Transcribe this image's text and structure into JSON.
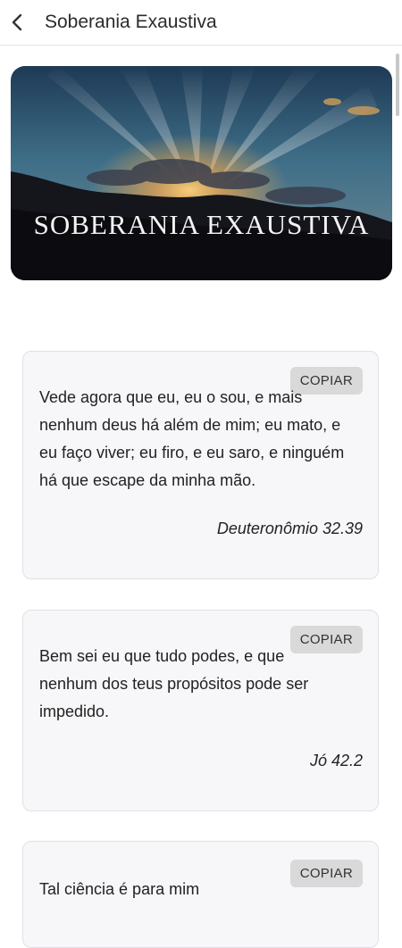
{
  "header": {
    "title": "Soberania Exaustiva",
    "back_icon": "chevron-left-icon"
  },
  "banner": {
    "text": "SOBERANIA EXAUSTIVA"
  },
  "cards": [
    {
      "copy_label": "COPIAR",
      "verse": "Vede agora que eu, eu o sou, e mais nenhum deus há além de mim; eu mato, e eu faço viver; eu firo, e eu saro, e ninguém há que escape da minha mão.",
      "reference": "Deuteronômio 32.39"
    },
    {
      "copy_label": "COPIAR",
      "verse": "Bem sei eu que tudo podes, e que nenhum dos teus propósitos pode ser impedido.",
      "reference": "Jó 42.2"
    },
    {
      "copy_label": "COPIAR",
      "verse": "Tal ciência é para mim"
    }
  ]
}
